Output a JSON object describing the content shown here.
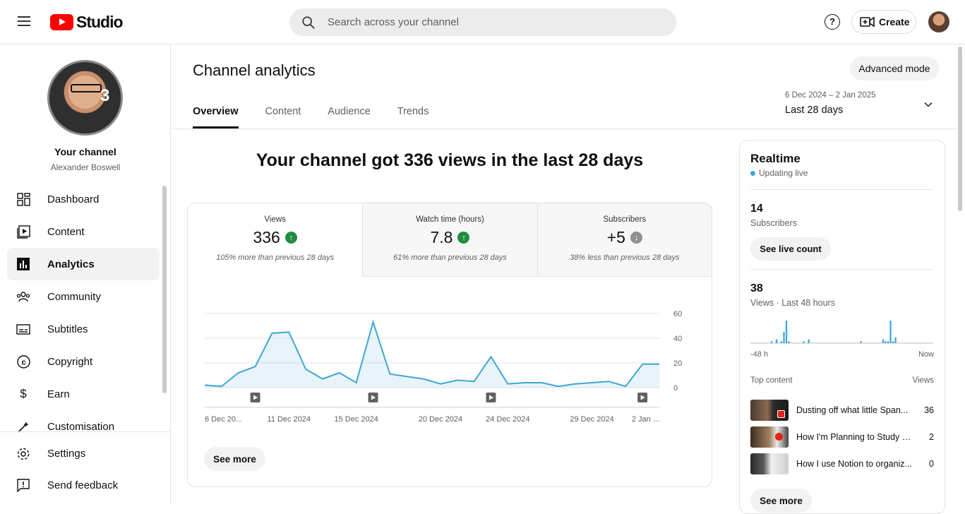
{
  "header": {
    "logo_text": "Studio",
    "search_placeholder": "Search across your channel",
    "help_label": "?",
    "create_label": "Create"
  },
  "sidebar": {
    "your_channel": "Your channel",
    "channel_name": "Alexander Boswell",
    "avatar_badge": "3",
    "items": [
      {
        "label": "Dashboard",
        "icon": "dashboard-icon"
      },
      {
        "label": "Content",
        "icon": "content-icon"
      },
      {
        "label": "Analytics",
        "icon": "analytics-icon",
        "active": true
      },
      {
        "label": "Community",
        "icon": "community-icon"
      },
      {
        "label": "Subtitles",
        "icon": "subtitles-icon"
      },
      {
        "label": "Copyright",
        "icon": "copyright-icon"
      },
      {
        "label": "Earn",
        "icon": "earn-icon"
      },
      {
        "label": "Customisation",
        "icon": "customisation-icon"
      }
    ],
    "bottom": [
      {
        "label": "Settings",
        "icon": "gear-icon"
      },
      {
        "label": "Send feedback",
        "icon": "feedback-icon"
      }
    ]
  },
  "main": {
    "title": "Channel analytics",
    "advanced_mode": "Advanced mode",
    "tabs": [
      "Overview",
      "Content",
      "Audience",
      "Trends"
    ],
    "date_range": {
      "dates": "6 Dec 2024 – 2 Jan 2025",
      "label": "Last 28 days"
    },
    "headline": "Your channel got 336 views in the last 28 days",
    "metrics": [
      {
        "label": "Views",
        "value": "336",
        "trend": "up",
        "note": "105% more than previous 28 days"
      },
      {
        "label": "Watch time (hours)",
        "value": "7.8",
        "trend": "up",
        "note": "61% more than previous 28 days"
      },
      {
        "label": "Subscribers",
        "value": "+5",
        "trend": "down",
        "note": "38% less than previous 28 days"
      }
    ],
    "see_more": "See more"
  },
  "chart_data": {
    "type": "area",
    "x": [
      "6 Dec",
      "7 Dec",
      "8 Dec",
      "9 Dec",
      "10 Dec",
      "11 Dec",
      "12 Dec",
      "13 Dec",
      "14 Dec",
      "15 Dec",
      "16 Dec",
      "17 Dec",
      "18 Dec",
      "19 Dec",
      "20 Dec",
      "21 Dec",
      "22 Dec",
      "23 Dec",
      "24 Dec",
      "25 Dec",
      "26 Dec",
      "27 Dec",
      "28 Dec",
      "29 Dec",
      "30 Dec",
      "31 Dec",
      "1 Jan",
      "2 Jan"
    ],
    "series": [
      {
        "values": [
          2,
          1,
          12,
          17,
          44,
          45,
          15,
          7,
          12,
          4,
          53,
          11,
          9,
          7,
          3,
          6,
          5,
          25,
          3,
          4,
          4,
          1,
          3,
          4,
          5,
          1,
          19,
          19
        ]
      }
    ],
    "ylim": [
      0,
      60
    ],
    "yticks": [
      "60",
      "40",
      "20",
      "0"
    ],
    "xtick_labels": [
      "6 Dec 20...",
      "11 Dec 2024",
      "15 Dec 2024",
      "20 Dec 2024",
      "24 Dec 2024",
      "29 Dec 2024",
      "2 Jan ..."
    ],
    "xtick_index": [
      0,
      5,
      9,
      14,
      18,
      23,
      27
    ],
    "upload_marker_index": [
      3,
      10,
      17,
      26
    ],
    "color": "#3ea6d6",
    "grid": true
  },
  "realtime": {
    "title": "Realtime",
    "status": "Updating live",
    "subscribers_value": "14",
    "subscribers_label": "Subscribers",
    "see_live": "See live count",
    "views_value": "38",
    "views_label": "Views · Last 48 hours",
    "bars": [
      0,
      0,
      0,
      0,
      0,
      0,
      0,
      0,
      1,
      0,
      2,
      0,
      1,
      6,
      12,
      1,
      0,
      0,
      0,
      0,
      0,
      1,
      0,
      2,
      0,
      0,
      0,
      0,
      0,
      0,
      0,
      0,
      0,
      0,
      0,
      0,
      0,
      0,
      0,
      0,
      0,
      0,
      0,
      0,
      1,
      0,
      0,
      0,
      0,
      0,
      0,
      0,
      0,
      2,
      1,
      1,
      12,
      1,
      3,
      0,
      0,
      0,
      0,
      0,
      0,
      0,
      0,
      0,
      0,
      0,
      0,
      0,
      0,
      0
    ],
    "bar_color": "#3ea6d6",
    "axis_start": "-48 h",
    "axis_end": "Now",
    "top_content_label": "Top content",
    "views_col": "Views",
    "items": [
      {
        "title": "Dusting off what little Span...",
        "views": "36"
      },
      {
        "title": "How I'm Planning to Study 4...",
        "views": "2"
      },
      {
        "title": "How I use Notion to organiz...",
        "views": "0"
      }
    ],
    "see_more": "See more"
  }
}
